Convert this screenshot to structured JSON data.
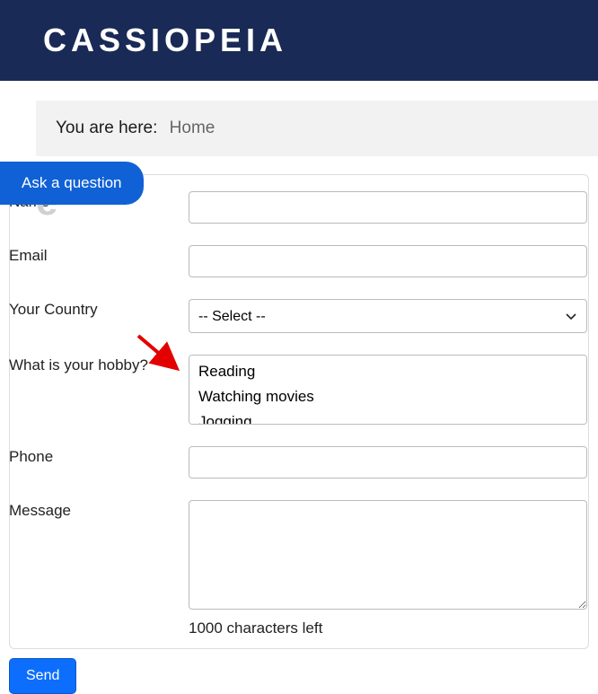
{
  "header": {
    "logo": "CASSIOPEIA"
  },
  "breadcrumb": {
    "label": "You are here:",
    "home": "Home"
  },
  "ask_button": "Ask a question",
  "page_title_partial": "e",
  "form": {
    "name": {
      "label": "Name",
      "value": ""
    },
    "email": {
      "label": "Email",
      "value": ""
    },
    "country": {
      "label": "Your Country",
      "selected": "-- Select --"
    },
    "hobby": {
      "label": "What is your hobby?",
      "options": [
        "Reading",
        "Watching movies",
        "Jogging"
      ]
    },
    "phone": {
      "label": "Phone",
      "value": ""
    },
    "message": {
      "label": "Message",
      "value": "",
      "counter": "1000 characters left"
    },
    "send": "Send"
  },
  "annotation": {
    "arrow_color": "#e30000"
  }
}
